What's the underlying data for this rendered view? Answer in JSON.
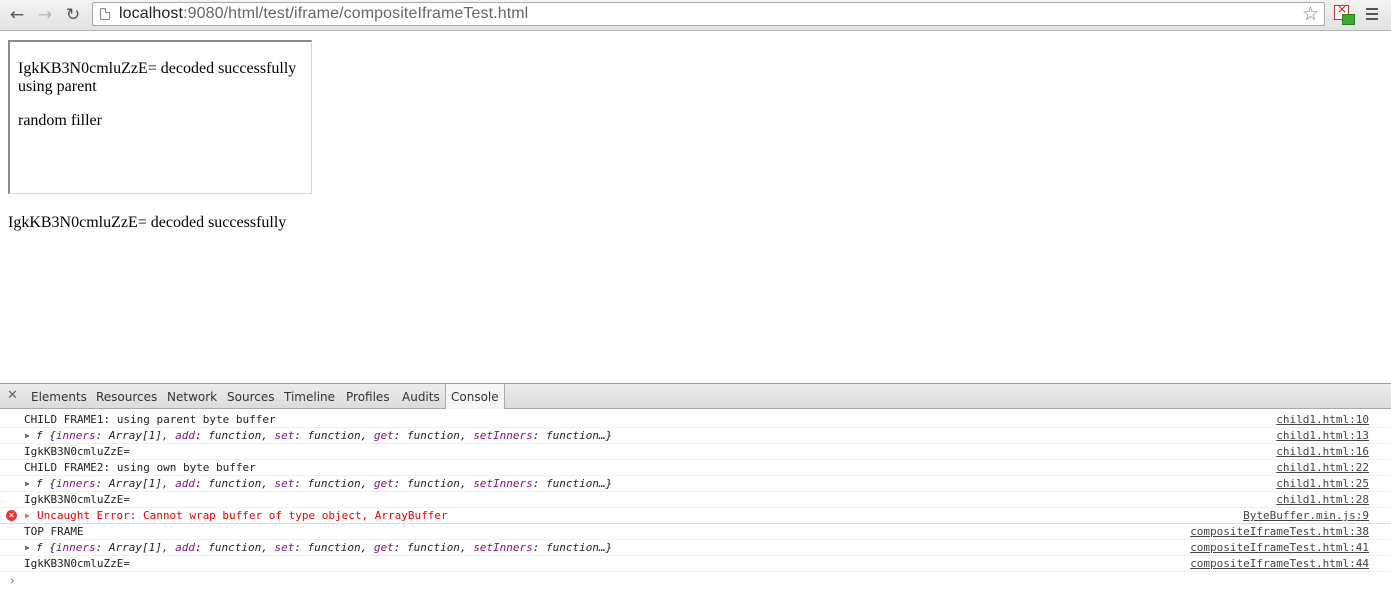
{
  "browser": {
    "url_host": "localhost",
    "url_rest": ":9080/html/test/iframe/compositeIframeTest.html"
  },
  "iframe": {
    "line1": "IgkKB3N0cmluZzE= decoded successfully using parent",
    "line2": "random filler"
  },
  "page": {
    "text": "IgkKB3N0cmluZzE= decoded successfully"
  },
  "devtools": {
    "tabs": [
      "Elements",
      "Resources",
      "Network",
      "Sources",
      "Timeline",
      "Profiles",
      "Audits",
      "Console"
    ],
    "active_tab": "Console"
  },
  "console": {
    "rows": [
      {
        "type": "log",
        "text": "CHILD FRAME1: using parent byte buffer",
        "source": "child1.html:10"
      },
      {
        "type": "object",
        "source": "child1.html:13"
      },
      {
        "type": "log",
        "text": "IgkKB3N0cmluZzE=",
        "source": "child1.html:16"
      },
      {
        "type": "log",
        "text": "CHILD FRAME2: using own byte buffer",
        "source": "child1.html:22"
      },
      {
        "type": "object",
        "source": "child1.html:25"
      },
      {
        "type": "log",
        "text": "IgkKB3N0cmluZzE=",
        "source": "child1.html:28"
      },
      {
        "type": "error",
        "text": "Uncaught Error: Cannot wrap buffer of type object, ArrayBuffer",
        "source": "ByteBuffer.min.js:9"
      },
      {
        "type": "log",
        "text": "TOP FRAME",
        "source": "compositeIframeTest.html:38"
      },
      {
        "type": "object",
        "source": "compositeIframeTest.html:41"
      },
      {
        "type": "log",
        "text": "IgkKB3N0cmluZzE=",
        "source": "compositeIframeTest.html:44"
      }
    ],
    "object_preview": {
      "name": "f",
      "open": "{",
      "k1": "inners",
      "v1": "Array[1]",
      "k2": "add",
      "v2": "function",
      "k3": "set",
      "v3": "function",
      "k4": "get",
      "v4": "function",
      "k5": "setInners",
      "v5": "function…}"
    },
    "prompt": "›"
  }
}
